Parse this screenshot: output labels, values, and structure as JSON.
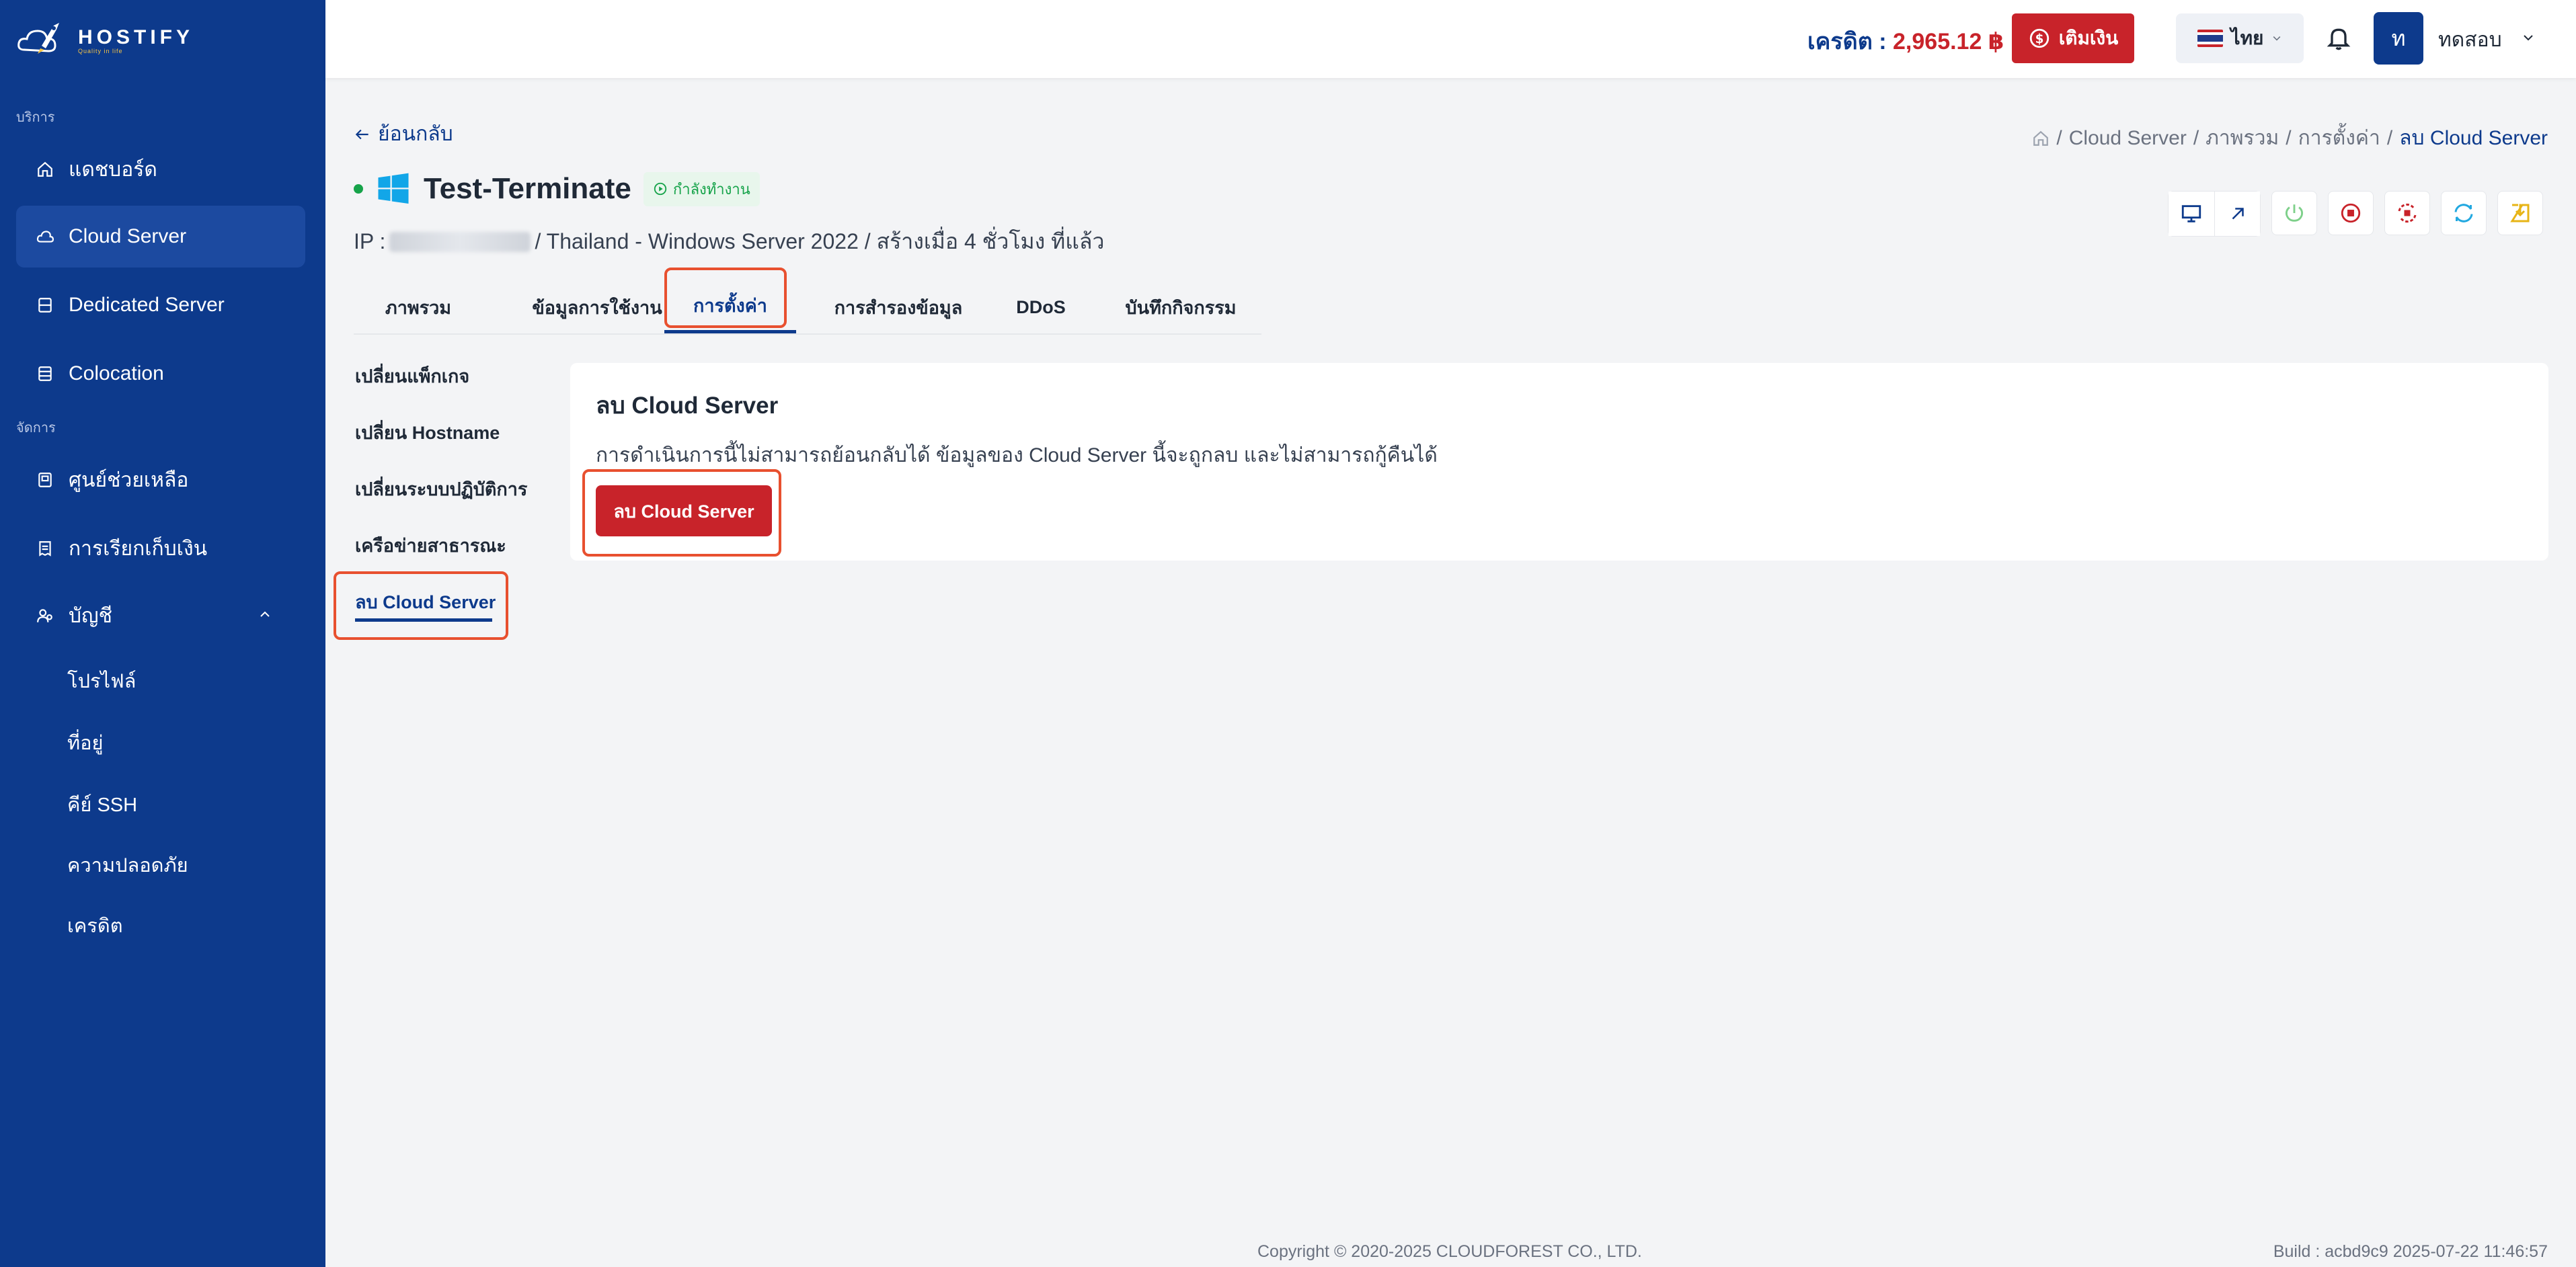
{
  "brand": {
    "name": "HOSTIFY",
    "tagline": "Quality in life"
  },
  "sidebar": {
    "section_service": "บริการ",
    "section_manage": "จัดการ",
    "items": [
      {
        "label": "แดชบอร์ด",
        "icon": "home-icon"
      },
      {
        "label": "Cloud Server",
        "icon": "cloud-icon"
      },
      {
        "label": "Dedicated Server",
        "icon": "server-icon"
      },
      {
        "label": "Colocation",
        "icon": "database-icon"
      },
      {
        "label": "ศูนย์ช่วยเหลือ",
        "icon": "help-book-icon"
      },
      {
        "label": "การเรียกเก็บเงิน",
        "icon": "receipt-icon"
      },
      {
        "label": "บัญชี",
        "icon": "users-icon"
      }
    ],
    "account_sub": [
      "โปรไฟล์",
      "ที่อยู่",
      "คีย์ SSH",
      "ความปลอดภัย",
      "เครดิต"
    ]
  },
  "header": {
    "credit_label": "เครดิต :",
    "credit_value": "2,965.12 ฿",
    "topup_label": "เติมเงิน",
    "language": "ไทย",
    "avatar_letter": "ท",
    "username": "ทดสอบ"
  },
  "page": {
    "back_label": "ย้อนกลับ",
    "breadcrumb": [
      "Cloud Server",
      "ภาพรวม",
      "การตั้งค่า",
      "ลบ Cloud Server"
    ],
    "server_name": "Test-Terminate",
    "status": "กำลังทำงาน",
    "ip_label": "IP :",
    "info_line": "/ Thailand - Windows Server 2022 / สร้างเมื่อ 4 ชั่วโมง ที่แล้ว",
    "tabs": [
      "ภาพรวม",
      "ข้อมูลการใช้งาน",
      "การตั้งค่า",
      "การสำรองข้อมูล",
      "DDoS",
      "บันทึกกิจกรรม"
    ],
    "settings_menu": [
      "เปลี่ยนแพ็กเกจ",
      "เปลี่ยน Hostname",
      "เปลี่ยนระบบปฏิบัติการ",
      "เครือข่ายสาธารณะ",
      "ลบ Cloud Server"
    ]
  },
  "panel": {
    "title": "ลบ Cloud Server",
    "description": "การดำเนินการนี้ไม่สามารถย้อนกลับได้ ข้อมูลของ Cloud Server นี้จะถูกลบ และไม่สามารถกู้คืนได้",
    "button_label": "ลบ Cloud Server"
  },
  "footer": {
    "copyright": "Copyright © 2020-2025 CLOUDFOREST CO., LTD.",
    "build": "Build : acbd9c9 2025-07-22 11:46:57"
  },
  "colors": {
    "sidebar_bg": "#0d3a8c",
    "accent_red": "#c8232a",
    "highlight_orange": "#e8502f",
    "status_green": "#16a34a"
  }
}
